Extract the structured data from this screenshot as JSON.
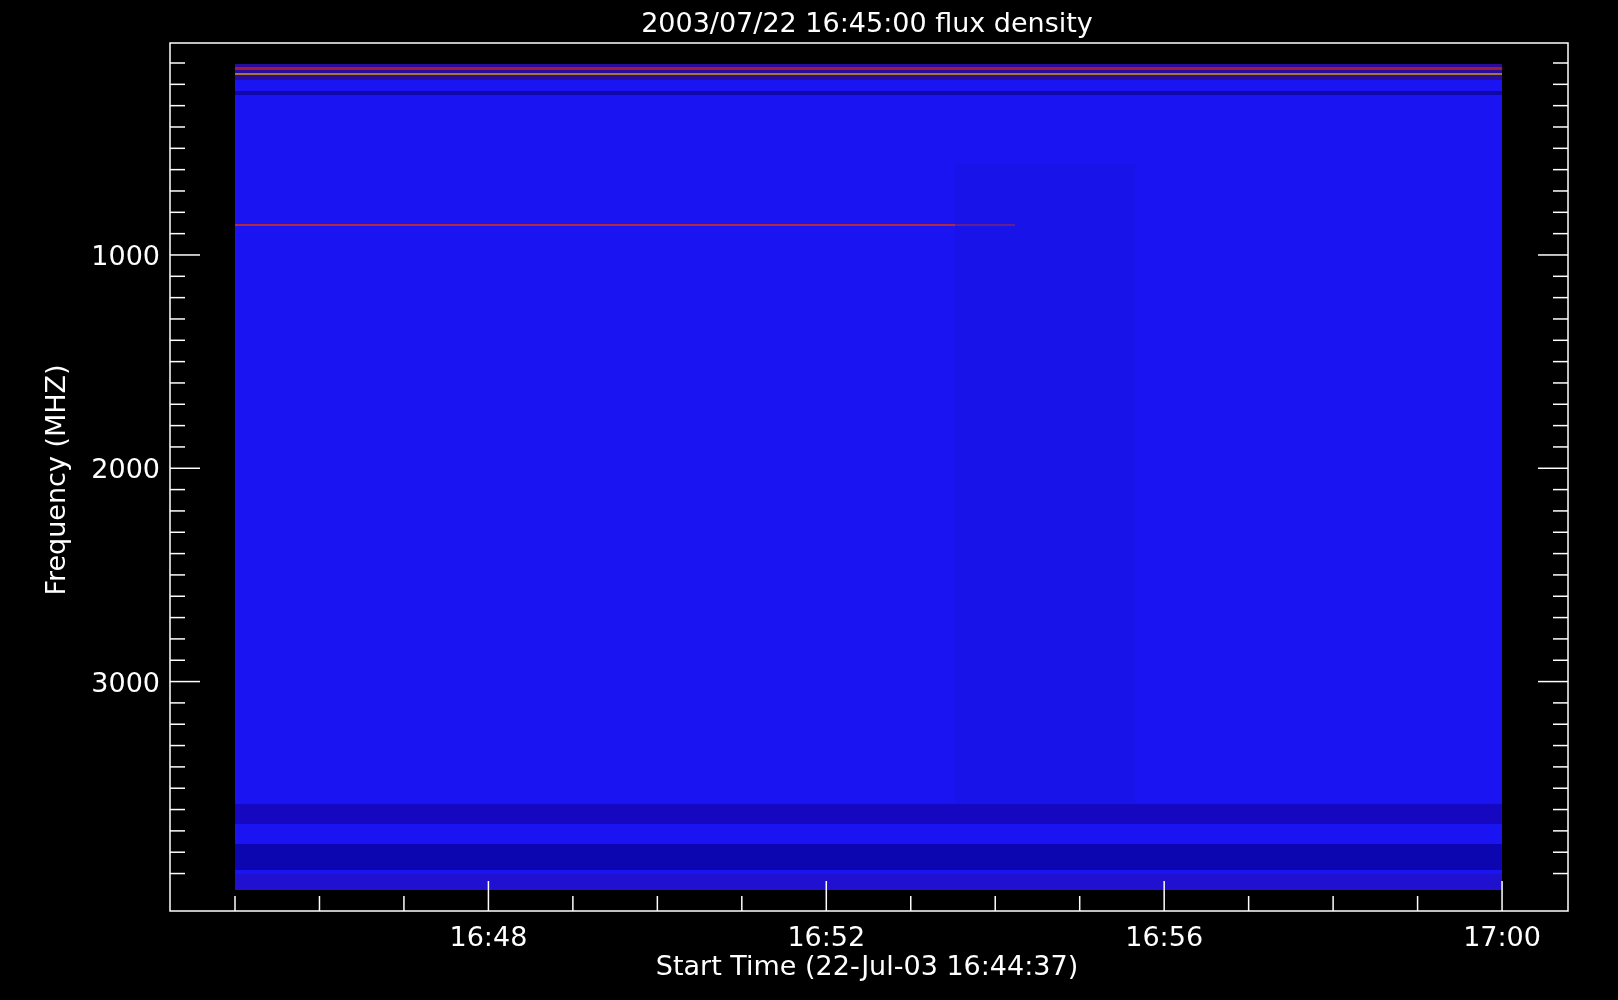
{
  "plot": {
    "title": "2003/07/22 16:45:00 flux density",
    "xlabel": "Start Time (22-Jul-03 16:44:37)",
    "ylabel": "Frequency (MHZ)",
    "xtick_labels": [
      "16:48",
      "16:52",
      "16:56",
      "17:00"
    ],
    "ytick_labels": [
      "1000",
      "2000",
      "3000"
    ]
  }
}
